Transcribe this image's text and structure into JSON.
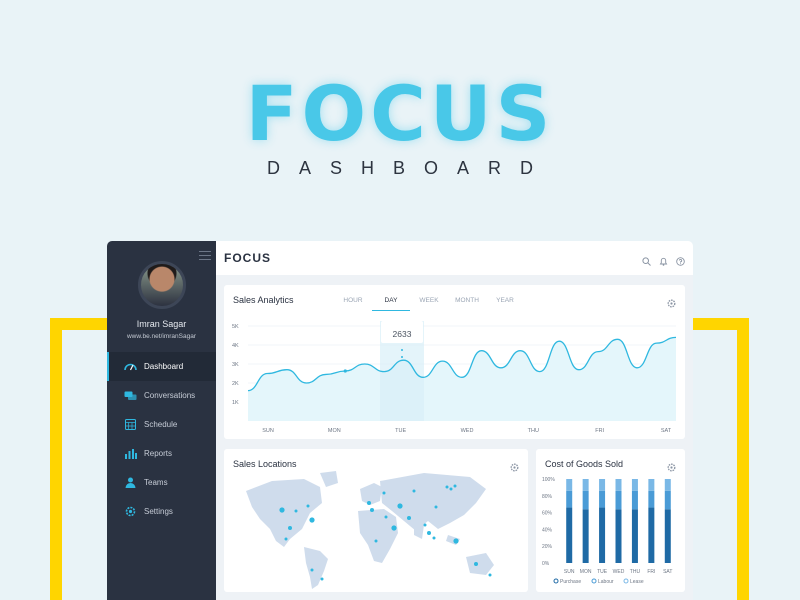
{
  "hero": {
    "title": "FOCUS",
    "subtitle": "DASHBOARD"
  },
  "sidebar": {
    "user_name": "Imran Sagar",
    "user_url": "www.be.net/imranSagar",
    "items": [
      {
        "label": "Dashboard",
        "icon": "speedometer-icon",
        "active": true
      },
      {
        "label": "Conversations",
        "icon": "chat-icon",
        "active": false
      },
      {
        "label": "Schedule",
        "icon": "calendar-icon",
        "active": false
      },
      {
        "label": "Reports",
        "icon": "bar-chart-icon",
        "active": false
      },
      {
        "label": "Teams",
        "icon": "user-icon",
        "active": false
      },
      {
        "label": "Settings",
        "icon": "gear-icon",
        "active": false
      }
    ]
  },
  "header": {
    "brand": "FOCUS",
    "icons": [
      "search-icon",
      "bell-icon",
      "help-icon"
    ]
  },
  "sales_analytics": {
    "title": "Sales Analytics",
    "tabs": [
      "HOUR",
      "DAY",
      "WEEK",
      "MONTH",
      "YEAR"
    ],
    "active_tab": "DAY",
    "tooltip_value": "2633"
  },
  "sales_locations": {
    "title": "Sales Locations"
  },
  "cost_of_goods": {
    "title": "Cost of Goods Sold"
  },
  "colors": {
    "accent": "#2fb8e0",
    "yellow": "#ffd500",
    "sidebar": "#2a3241",
    "bar_dark": "#1f6aa5",
    "bar_light": "#4a9bd6"
  },
  "chart_data": [
    {
      "type": "line",
      "title": "Sales Analytics",
      "x": [
        "SUN",
        "MON",
        "TUE",
        "WED",
        "THU",
        "FRI",
        "SAT"
      ],
      "y_ticks": [
        "5K",
        "4K",
        "3K",
        "2K",
        "1K"
      ],
      "ylim": [
        0,
        5000
      ],
      "series": [
        {
          "values": [
            1600,
            2500,
            2700,
            2000,
            2450,
            2633,
            3000,
            2600,
            3200,
            2300,
            3150,
            2300,
            3700,
            2800,
            3700,
            2600,
            4200,
            2700,
            3650,
            4300,
            2800,
            4100,
            4400
          ]
        }
      ],
      "grid": true
    },
    {
      "type": "bar",
      "title": "Cost of Goods Sold",
      "categories": [
        "SUN",
        "MON",
        "TUE",
        "WED",
        "THU",
        "FRI",
        "SAT"
      ],
      "y_ticks": [
        "100%",
        "80%",
        "60%",
        "40%",
        "20%",
        "0%"
      ],
      "ylim": [
        0,
        100
      ],
      "series": [
        {
          "name": "Purchase",
          "values": [
            66,
            64,
            66,
            64,
            64,
            66,
            64
          ]
        },
        {
          "name": "Labour",
          "values": [
            20,
            22,
            20,
            22,
            22,
            20,
            22
          ]
        },
        {
          "name": "Lease",
          "values": [
            14,
            14,
            14,
            14,
            14,
            14,
            14
          ]
        }
      ],
      "legend": "bottom"
    }
  ]
}
